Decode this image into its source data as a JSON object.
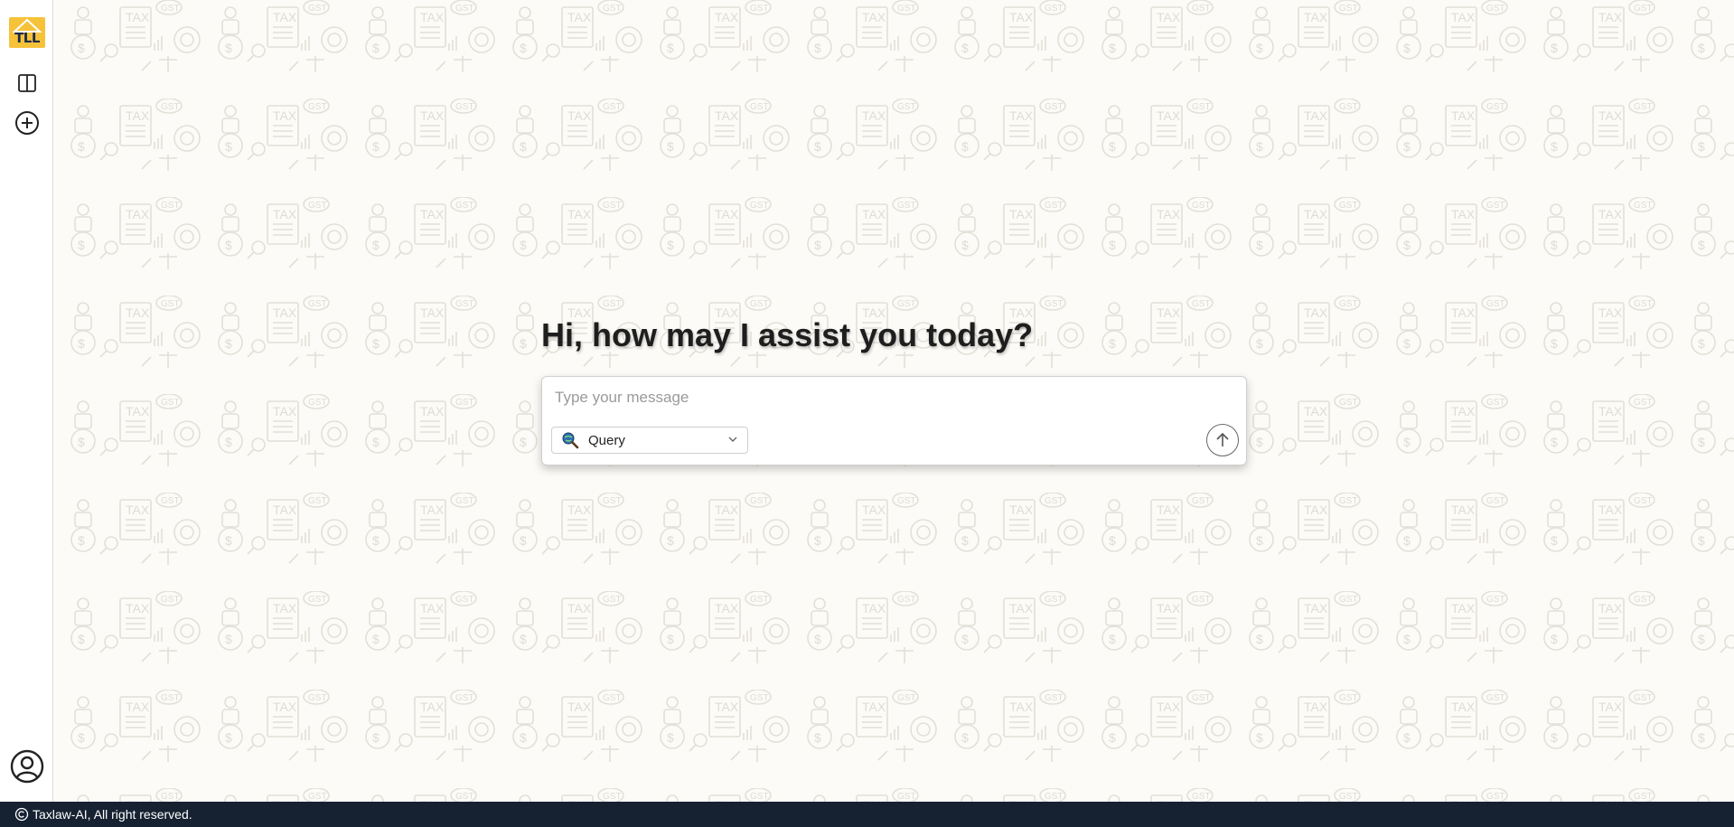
{
  "sidebar": {
    "logo_text": "TLL",
    "panel_icon": "panel-toggle-icon",
    "new_chat_icon": "plus-circle-icon",
    "profile_icon": "user-circle-icon"
  },
  "main": {
    "greeting": "Hi, how may I assist you today?",
    "input_placeholder": "Type your message",
    "mode": {
      "selected": "Query",
      "icon": "magnifier-globe-icon"
    },
    "send_icon": "arrow-up-icon"
  },
  "footer": {
    "copyright_icon": "copyright-icon",
    "text": "Taxlaw-AI, All right reserved."
  },
  "colors": {
    "background": "#fcfbf7",
    "logo": "#f5c23a",
    "footer": "#162232",
    "pattern": "#e6e4dc"
  }
}
